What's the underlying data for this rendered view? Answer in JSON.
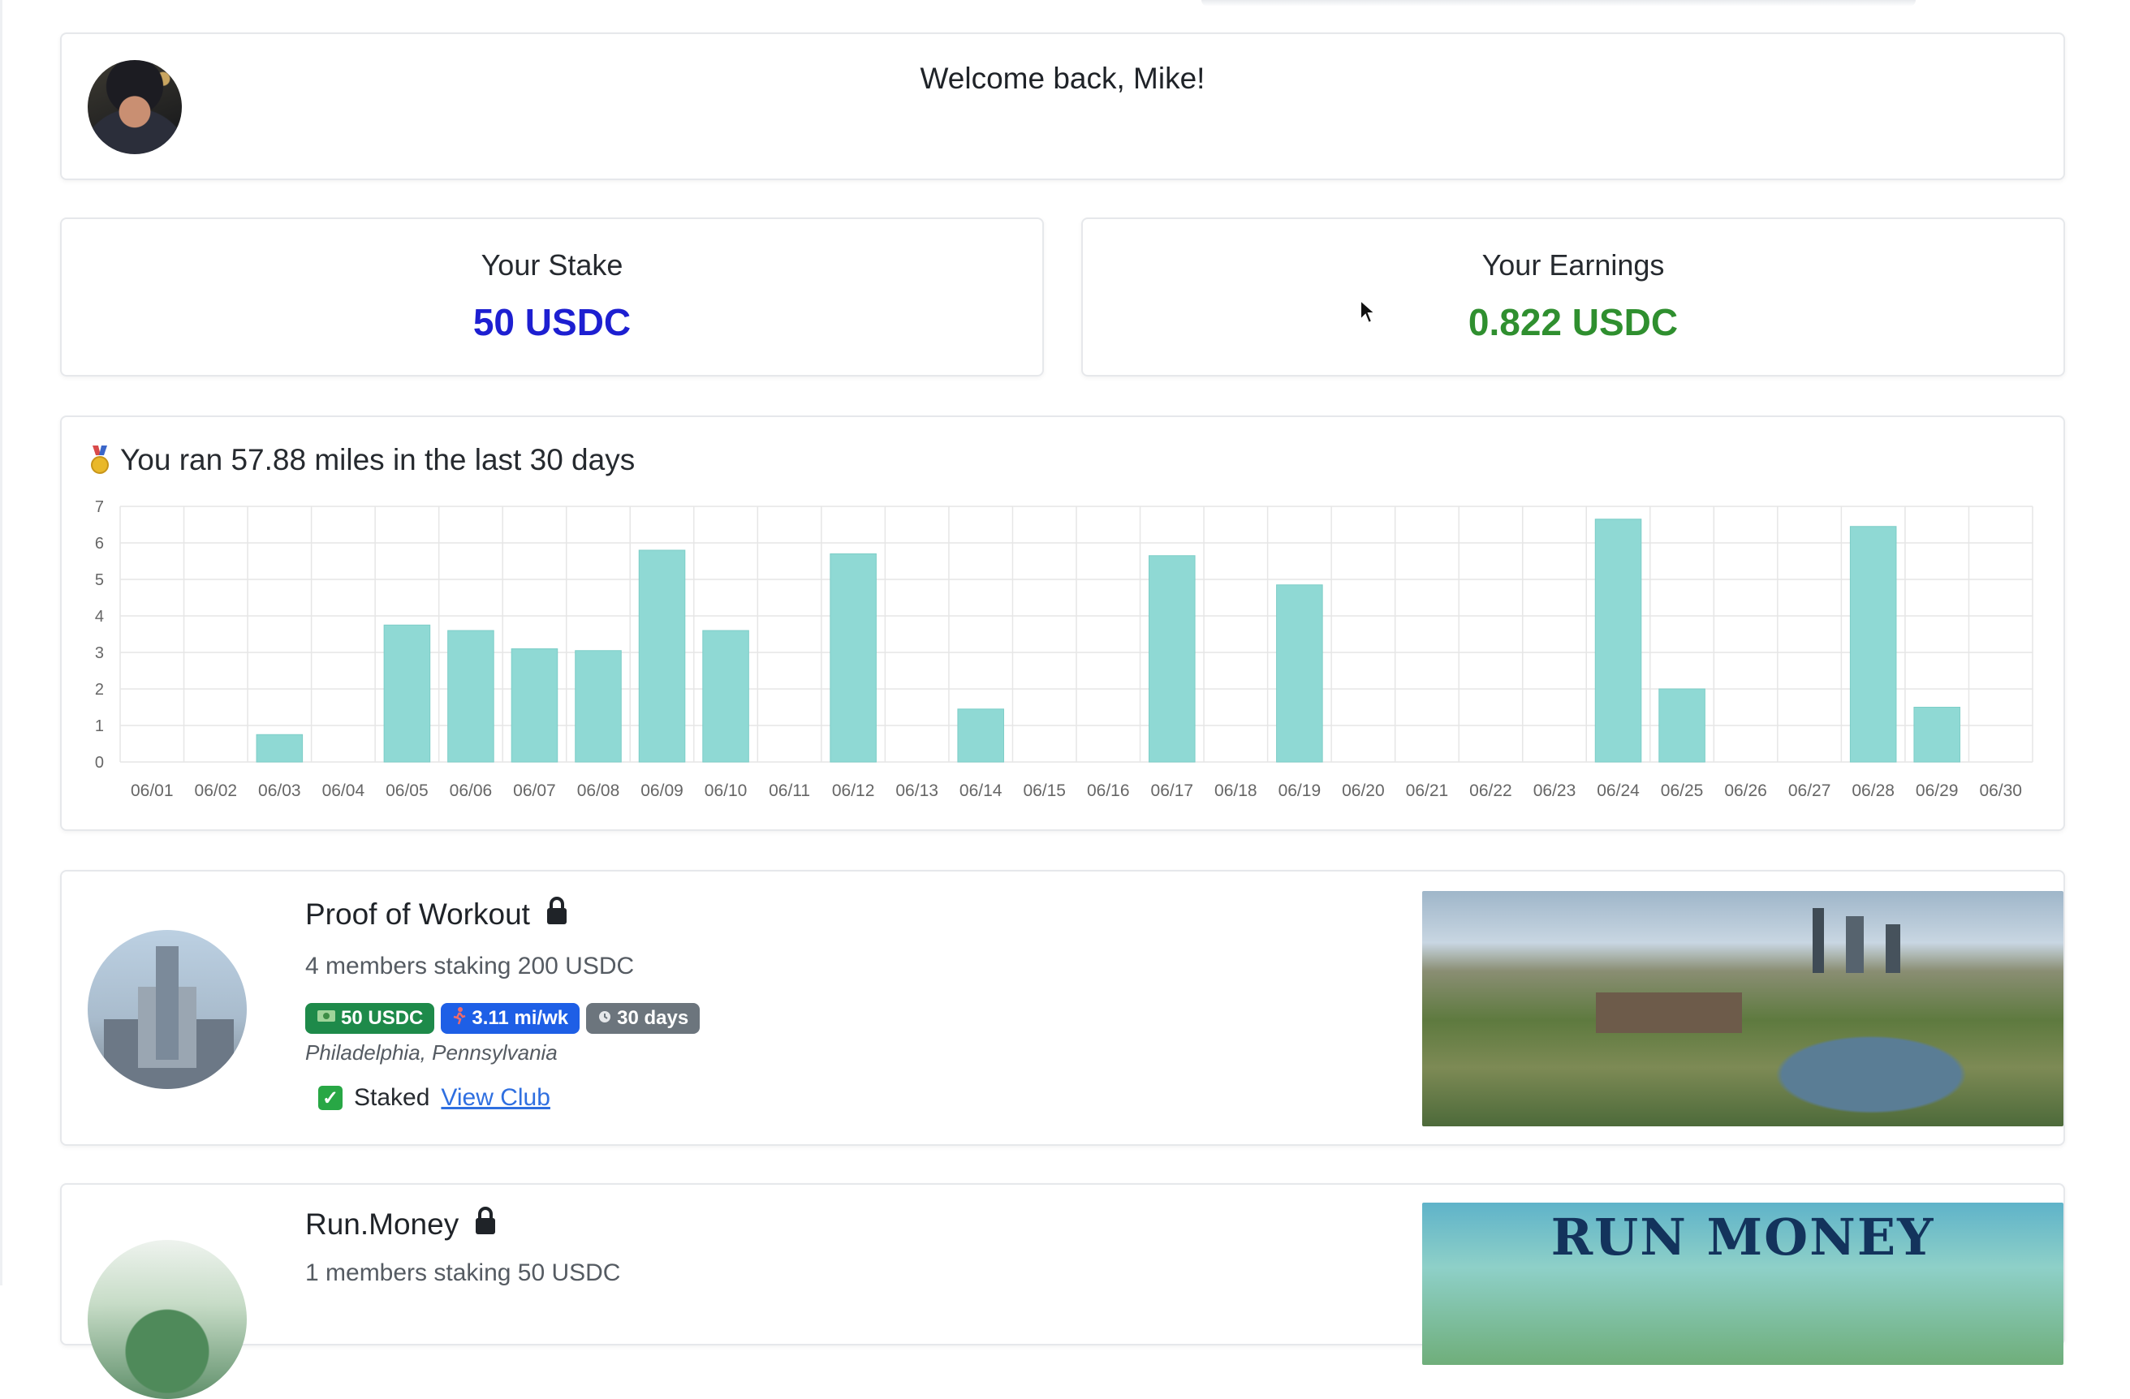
{
  "welcome": {
    "message": "Welcome back, Mike!"
  },
  "stats": {
    "stake": {
      "label": "Your Stake",
      "value": "50 USDC",
      "color": "#1d1fd1"
    },
    "earnings": {
      "label": "Your Earnings",
      "value": "0.822 USDC",
      "color": "#2f8f2f"
    }
  },
  "chart": {
    "title": "You ran 57.88 miles in the last 30 days",
    "icon": "medal-icon"
  },
  "chart_data": {
    "type": "bar",
    "title": "You ran 57.88 miles in the last 30 days",
    "xlabel": "",
    "ylabel": "",
    "ylim": [
      0,
      7
    ],
    "yticks": [
      0,
      1,
      2,
      3,
      4,
      5,
      6,
      7
    ],
    "grid": true,
    "bar_color": "#8fd9d4",
    "categories": [
      "06/01",
      "06/02",
      "06/03",
      "06/04",
      "06/05",
      "06/06",
      "06/07",
      "06/08",
      "06/09",
      "06/10",
      "06/11",
      "06/12",
      "06/13",
      "06/14",
      "06/15",
      "06/16",
      "06/17",
      "06/18",
      "06/19",
      "06/20",
      "06/21",
      "06/22",
      "06/23",
      "06/24",
      "06/25",
      "06/26",
      "06/27",
      "06/28",
      "06/29",
      "06/30"
    ],
    "values": [
      0,
      0,
      0.75,
      0,
      3.75,
      3.6,
      3.1,
      3.05,
      5.8,
      3.6,
      0,
      5.7,
      0,
      1.45,
      0,
      0,
      5.65,
      0,
      4.85,
      0,
      0,
      0,
      0,
      6.65,
      2.0,
      0,
      0,
      6.45,
      1.5,
      0
    ]
  },
  "clubs": [
    {
      "name": "Proof of Workout",
      "members": "4 members staking 200 USDC",
      "badges": [
        {
          "icon": "money-icon",
          "label": "50 USDC",
          "color": "#1e8a4a"
        },
        {
          "icon": "runner-icon",
          "label": "3.11 mi/wk",
          "color": "#1e5fe6"
        },
        {
          "icon": "clock-icon",
          "label": "30 days",
          "color": "#6c757d"
        }
      ],
      "location": "Philadelphia, Pennsylvania",
      "status": "Staked",
      "link": "View Club"
    },
    {
      "name": "Run.Money",
      "members": "1 members staking 50 USDC",
      "image_text": "RUN MONEY"
    }
  ]
}
